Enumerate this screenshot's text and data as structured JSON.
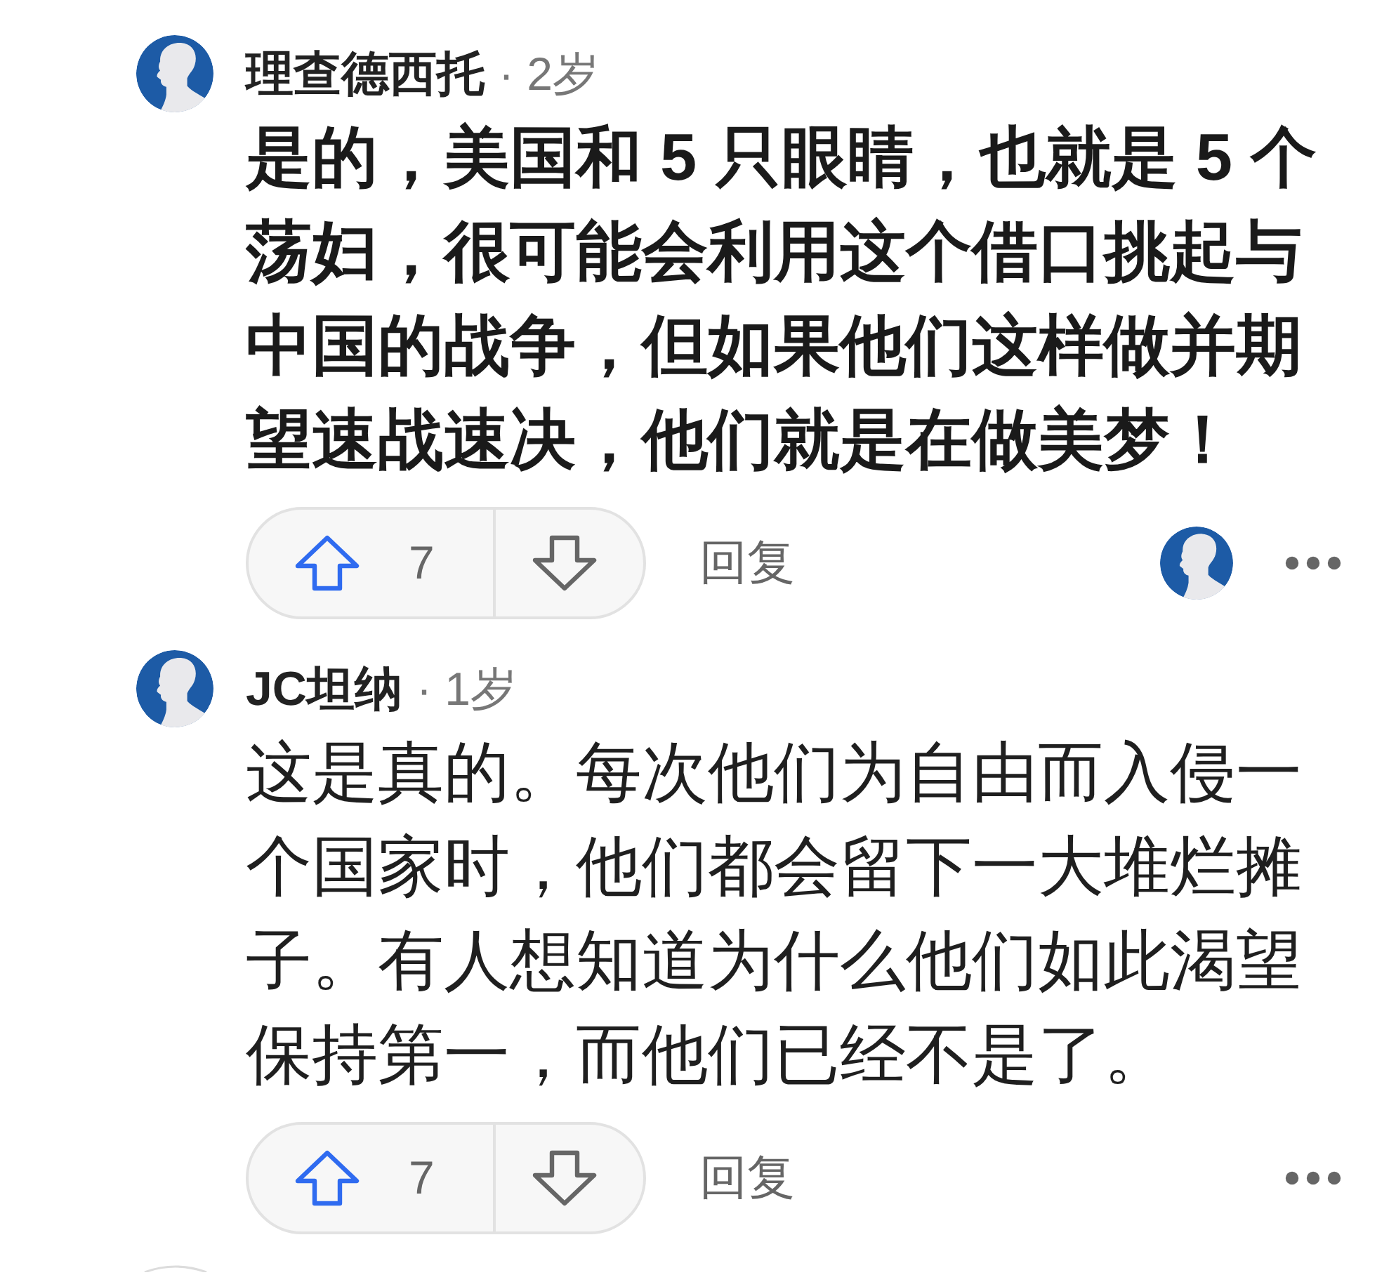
{
  "comments": [
    {
      "author": "理查德西托",
      "age": "· 2岁",
      "body": "是的，美国和 5 只眼睛，也就是 5 个荡妇，很可能会利用这个借口挑起与中国的战争，但如果他们这样做并期望速战速决，他们就是在做美梦！",
      "bold": true,
      "upvotes": "7",
      "reply_label": "回复",
      "replier_avatar": true
    },
    {
      "author": "JC坦纳",
      "age": "· 1岁",
      "body": "这是真的。每次他们为自由而入侵一个国家时，他们都会留下一大堆烂摊子。有人想知道为什么他们如此渴望保持第一，而他们已经不是了。",
      "bold": false,
      "upvotes": "7",
      "reply_label": "回复",
      "replier_avatar": false
    }
  ]
}
